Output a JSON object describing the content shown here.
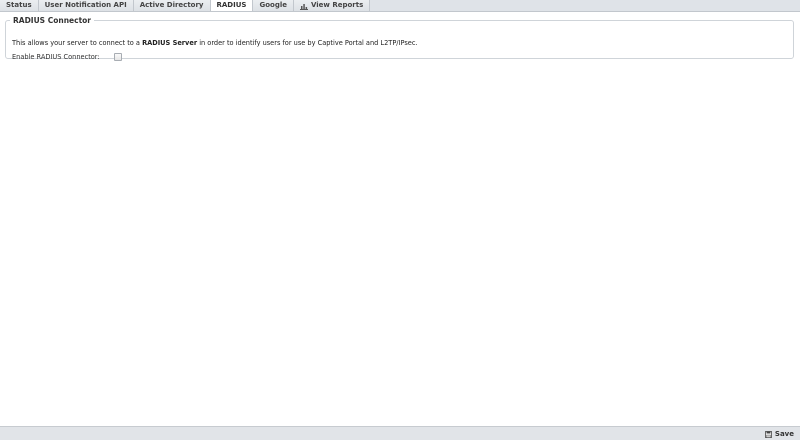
{
  "tabs": [
    {
      "label": "Status"
    },
    {
      "label": "User Notification API"
    },
    {
      "label": "Active Directory"
    },
    {
      "label": "RADIUS",
      "active": true
    },
    {
      "label": "Google"
    },
    {
      "label": "View Reports",
      "icon": "chart-icon"
    }
  ],
  "section": {
    "title": "RADIUS Connector",
    "description_prefix": "This allows your server to connect to a ",
    "description_bold": "RADIUS Server",
    "description_suffix": " in order to identify users for use by Captive Portal and L2TP/IPsec.",
    "enable_label": "Enable RADIUS Connector:",
    "enable_checked": false
  },
  "footer": {
    "save_label": "Save",
    "save_icon": "floppy-disk-icon"
  }
}
